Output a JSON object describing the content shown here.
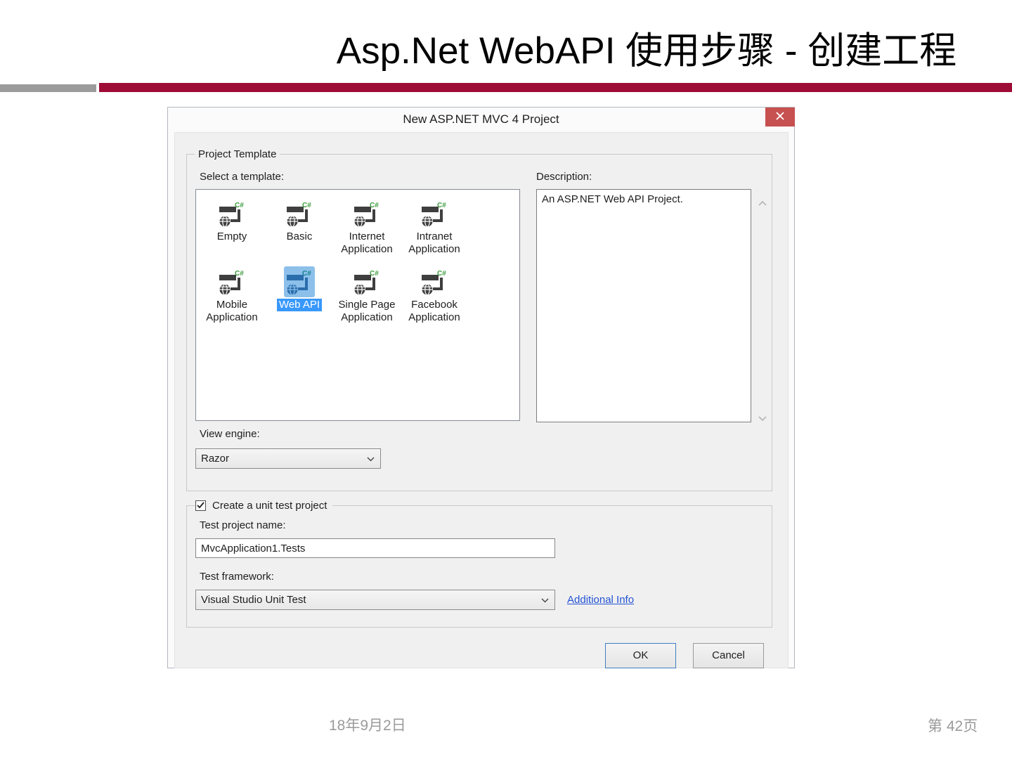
{
  "slide": {
    "title": "Asp.Net WebAPI 使用步骤 - 创建工程",
    "footer_date": "18年9月2日",
    "footer_page": "第 42页",
    "accent_red": "#9E0D35",
    "accent_gray": "#9B9B9B"
  },
  "dialog": {
    "title": "New ASP.NET MVC 4 Project",
    "close_label": "✕",
    "close_color": "#C75050",
    "selection_color": "#3898FC",
    "project_template": {
      "legend": "Project Template",
      "select_label": "Select a template:",
      "templates": [
        {
          "label": "Empty",
          "selected": false
        },
        {
          "label": "Basic",
          "selected": false
        },
        {
          "label": "Internet Application",
          "selected": false
        },
        {
          "label": "Intranet Application",
          "selected": false
        },
        {
          "label": "Mobile Application",
          "selected": false
        },
        {
          "label": "Web API",
          "selected": true
        },
        {
          "label": "Single Page Application",
          "selected": false
        },
        {
          "label": "Facebook Application",
          "selected": false
        }
      ],
      "description_label": "Description:",
      "description_text": "An ASP.NET Web API Project.",
      "view_engine_label": "View engine:",
      "view_engine_value": "Razor"
    },
    "unit_test": {
      "checkbox_label": "Create a unit test project",
      "checkbox_checked": true,
      "name_label": "Test project name:",
      "name_value": "MvcApplication1.Tests",
      "framework_label": "Test framework:",
      "framework_value": "Visual Studio Unit Test",
      "link_label": "Additional Info"
    },
    "ok_label": "OK",
    "cancel_label": "Cancel"
  }
}
